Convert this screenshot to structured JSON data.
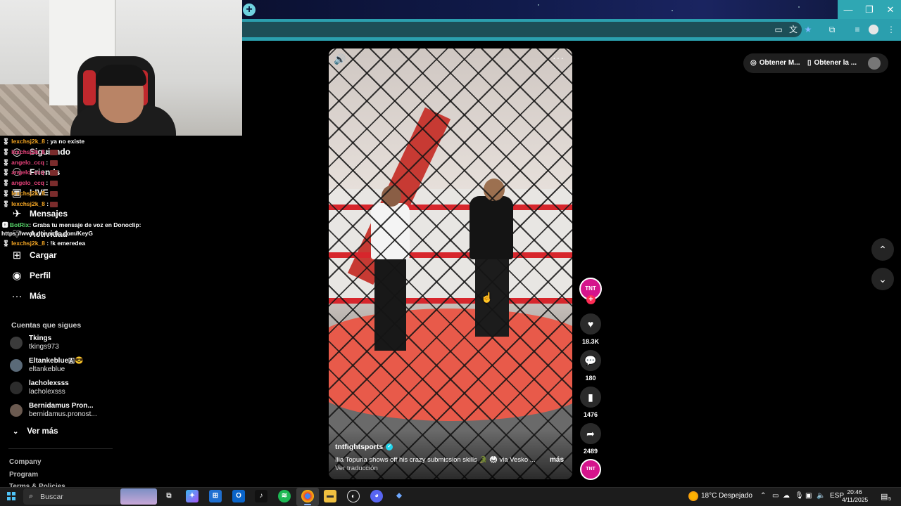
{
  "browser": {
    "new_tab_label": "+",
    "window": {
      "minimize": "—",
      "maximize": "❐",
      "close": "✕"
    }
  },
  "chat": [
    {
      "user": "lexchsj2k_8",
      "message": ": ya no existe",
      "color": "orange",
      "emote": false
    },
    {
      "user": "lexchsj2k_8",
      "message": ":",
      "color": "pink",
      "emote": true
    },
    {
      "user": "angelo_ccq",
      "message": ":",
      "color": "pink",
      "emote": true
    },
    {
      "user": "angelo_ccq",
      "message": ":",
      "color": "pink",
      "emote": true
    },
    {
      "user": "angelo_ccq",
      "message": ":",
      "color": "pink",
      "emote": true
    },
    {
      "user": "lexchsj2k_8",
      "message": ":",
      "color": "orange",
      "emote": true
    },
    {
      "user": "lexchsj2k_8",
      "message": ":",
      "color": "orange",
      "emote": true
    },
    {
      "user": "BotRix",
      "message": ": Graba tu mensaje de voz en Donoclip:",
      "color": "green",
      "emote": false
    },
    {
      "user": "",
      "message": "https://www.donoclip.com/KeyG",
      "color": "white",
      "emote": false
    },
    {
      "user": "lexchsj2k_8",
      "message": ": !k emeredea",
      "color": "orange",
      "emote": false
    }
  ],
  "sidebar": {
    "nav": [
      {
        "label": "Siguiendo",
        "icon": "people-icon"
      },
      {
        "label": "Friends",
        "icon": "friends-icon"
      },
      {
        "label": "LIVE",
        "icon": "live-icon"
      },
      {
        "label": "Mensajes",
        "icon": "messages-icon"
      },
      {
        "label": "Actividad",
        "icon": "activity-icon"
      },
      {
        "label": "Cargar",
        "icon": "upload-icon"
      },
      {
        "label": "Perfil",
        "icon": "profile-icon"
      },
      {
        "label": "Más",
        "icon": "more-icon"
      }
    ],
    "following_title": "Cuentas que sigues",
    "following": [
      {
        "name": "Tkings",
        "handle": "tkings973"
      },
      {
        "name": "Eltankeblue🇦😎",
        "handle": "eltankeblue"
      },
      {
        "name": "lacholexsss",
        "handle": "lacholexsss"
      },
      {
        "name": "Bernidamus Pron...",
        "handle": "bernidamus.pronost..."
      }
    ],
    "see_more": "Ver más",
    "footer": [
      "Company",
      "Program",
      "Terms & Policies"
    ]
  },
  "video": {
    "author": "tntfightsports",
    "caption": "Ilia Topuria shows off his crazy submission skills 🐊 🥋 via Vesko ...",
    "more": "más",
    "translate": "Ver traducción",
    "volume_icon": "🔊",
    "options": "···"
  },
  "rail": {
    "avatar_text": "TNT",
    "likes": "18.3K",
    "comments": "180",
    "saves": "1476",
    "shares": "2489"
  },
  "top_right": {
    "get_coins": "Obtener M...",
    "get_app": "Obtener la ..."
  },
  "taskbar": {
    "search_placeholder": "Buscar",
    "weather": "18°C Despejado",
    "language": "ESP",
    "time": "20:46",
    "date": "4/11/2025",
    "notification_count": "5"
  }
}
